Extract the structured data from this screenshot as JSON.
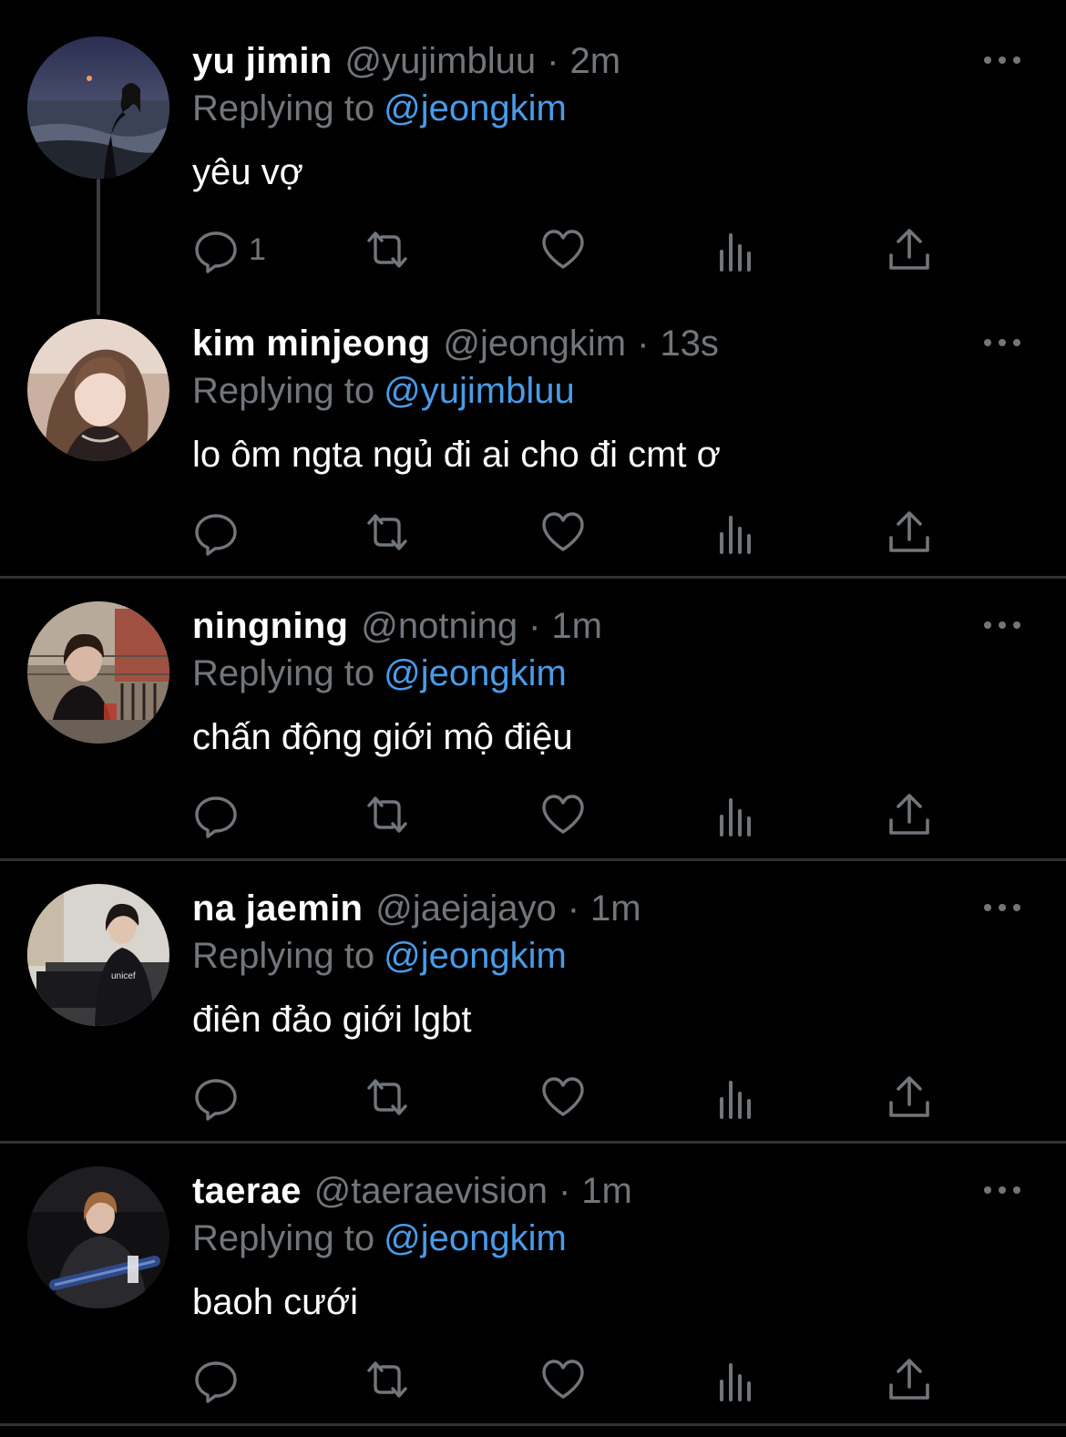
{
  "colors": {
    "background": "#000000",
    "name": "#ffffff",
    "muted": "#71767b",
    "mention": "#4a9be8",
    "divider": "#2f3336"
  },
  "icons": {
    "reply": "speech-bubble-icon",
    "retweet": "retweet-arrows-icon",
    "like": "heart-icon",
    "views": "bar-chart-icon",
    "share": "share-upload-icon",
    "more": "three-dots-icon"
  },
  "tweets": [
    {
      "name": "yu jimin",
      "handle": "@yujimbluu",
      "separator": "·",
      "time": "2m",
      "replying_prefix": "Replying to",
      "replying_to": "@jeongkim",
      "text": "yêu vợ",
      "reply_count": "1"
    },
    {
      "name": "kim minjeong",
      "handle": "@jeongkim",
      "separator": "·",
      "time": "13s",
      "replying_prefix": "Replying to",
      "replying_to": "@yujimbluu",
      "text": "lo ôm ngta ngủ đi ai cho đi cmt ơ",
      "reply_count": ""
    },
    {
      "name": "ningning",
      "handle": "@notning",
      "separator": "·",
      "time": "1m",
      "replying_prefix": "Replying to",
      "replying_to": "@jeongkim",
      "text": "chấn động giới mộ điệu",
      "reply_count": ""
    },
    {
      "name": "na jaemin",
      "handle": "@jaejajayo",
      "separator": "·",
      "time": "1m",
      "replying_prefix": "Replying to",
      "replying_to": "@jeongkim",
      "text": "điên đảo giới lgbt",
      "reply_count": ""
    },
    {
      "name": "taerae",
      "handle": "@taeraevision",
      "separator": "·",
      "time": "1m",
      "replying_prefix": "Replying to",
      "replying_to": "@jeongkim",
      "text": "baoh cưới",
      "reply_count": ""
    }
  ]
}
